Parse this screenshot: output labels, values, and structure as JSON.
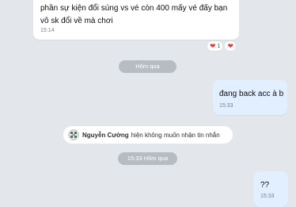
{
  "incoming_message": {
    "text": "phần sự kiện đổi súng vs vé còn 400 mấy vé đấy bạn vô sk đổi về mà chơi",
    "time": "15:14"
  },
  "reactions": [
    {
      "icon": "heart-icon",
      "count": "1"
    },
    {
      "icon": "heart-icon",
      "count": ""
    }
  ],
  "date_divider_1": "Hôm qua",
  "outgoing_message_1": {
    "text": "đang back acc à b",
    "time": "15:33"
  },
  "notice": {
    "name": "Nguyễn Cường",
    "text": "hiện không muốn nhận tin nhắn"
  },
  "date_divider_2": "15:33 Hôm qua",
  "outgoing_message_2": {
    "text": "??",
    "time": "15:33"
  },
  "colors": {
    "heart": "#e53a3a",
    "outgoing_bubble": "#e2efff",
    "background": "#e3e7ec"
  }
}
